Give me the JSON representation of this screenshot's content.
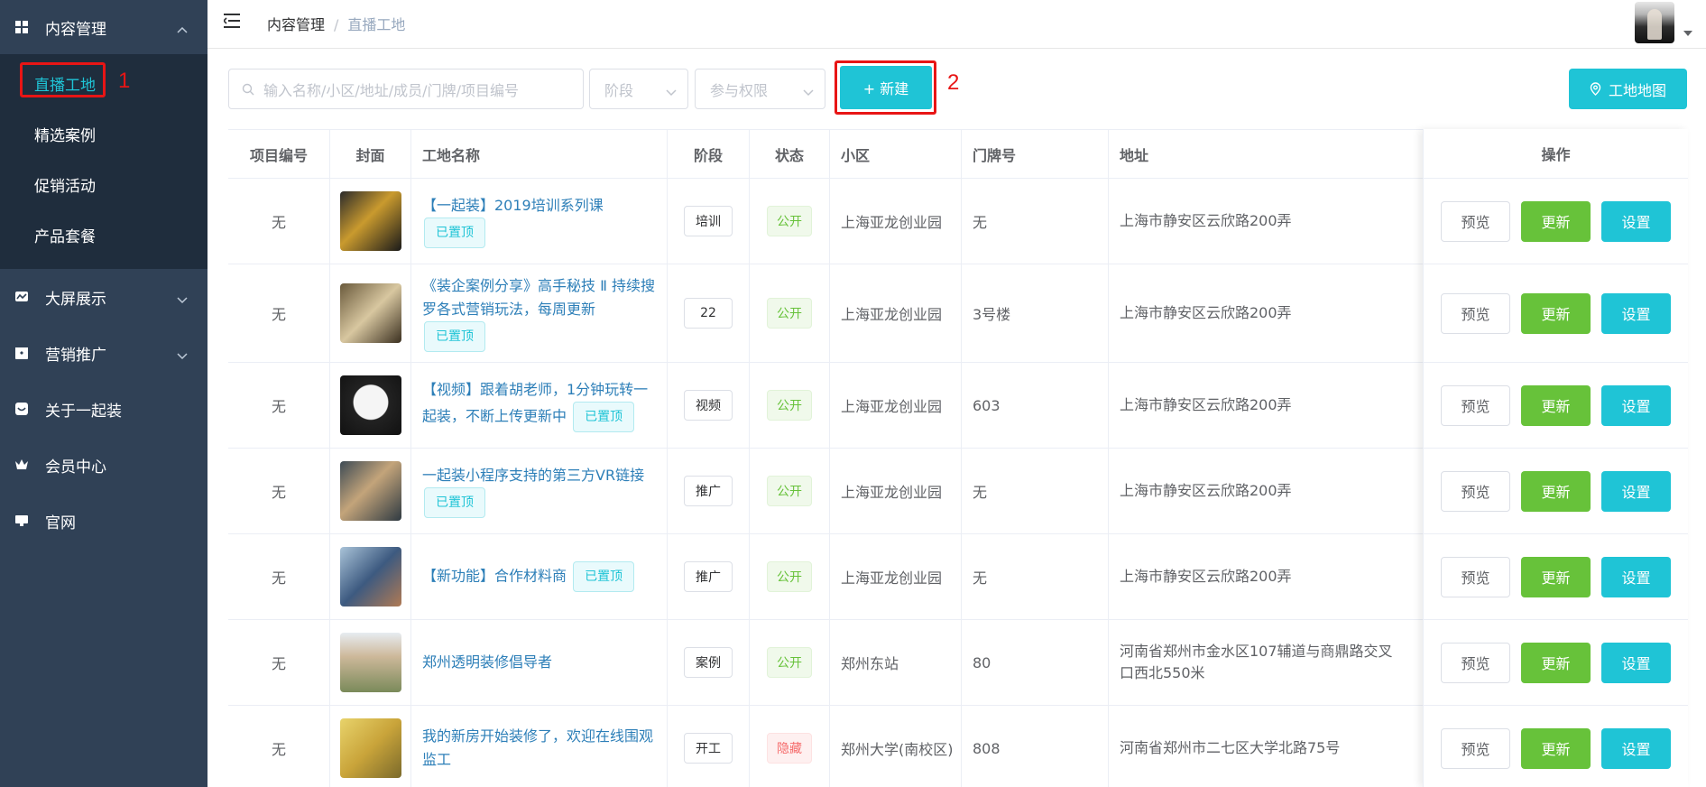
{
  "sidebar": {
    "top": {
      "label": "内容管理",
      "icon": "grid-icon"
    },
    "sub_items": [
      {
        "label": "直播工地",
        "active": true
      },
      {
        "label": "精选案例"
      },
      {
        "label": "促销活动"
      },
      {
        "label": "产品套餐"
      }
    ],
    "items": [
      {
        "label": "大屏展示",
        "icon": "chart-icon",
        "has_arrow": true
      },
      {
        "label": "营销推广",
        "icon": "gift-icon",
        "has_arrow": true
      },
      {
        "label": "关于一起装",
        "icon": "info-icon",
        "has_arrow": false
      },
      {
        "label": "会员中心",
        "icon": "crown-icon",
        "has_arrow": false
      },
      {
        "label": "官网",
        "icon": "monitor-icon",
        "has_arrow": false
      }
    ]
  },
  "annotations": {
    "n1": "1",
    "n2": "2"
  },
  "header": {
    "breadcrumb": [
      "内容管理",
      "直播工地"
    ],
    "separator": "/"
  },
  "filters": {
    "search_placeholder": "输入名称/小区/地址/成员/门牌/项目编号",
    "stage_placeholder": "阶段",
    "permission_placeholder": "参与权限"
  },
  "buttons": {
    "new": "+ 新建",
    "map": "工地地图"
  },
  "colors": {
    "sidebar_bg": "#304156",
    "submenu_bg": "#1f2d3d",
    "accent": "#1fc4d6",
    "success": "#67c23a",
    "danger": "#f56c6c",
    "highlight": "#e81515"
  },
  "table": {
    "headers": [
      "项目编号",
      "封面",
      "工地名称",
      "阶段",
      "状态",
      "小区",
      "门牌号",
      "地址",
      "操作"
    ],
    "rows": [
      {
        "no": "无",
        "cover": "cover-1",
        "title": "【一起装】2019培训系列课",
        "pinned": "已置顶",
        "stage": "培训",
        "status": "公开",
        "status_type": "pub",
        "community": "上海亚龙创业园",
        "door": "无",
        "address": "上海市静安区云欣路200弄"
      },
      {
        "no": "无",
        "cover": "cover-2",
        "title": "《装企案例分享》高手秘技 Ⅱ 持续搜罗各式营销玩法，每周更新",
        "pinned": "已置顶",
        "stage": "22",
        "status": "公开",
        "status_type": "pub",
        "community": "上海亚龙创业园",
        "door": "3号楼",
        "address": "上海市静安区云欣路200弄"
      },
      {
        "no": "无",
        "cover": "cover-3",
        "title": "【视频】跟着胡老师，1分钟玩转一起装，不断上传更新中",
        "pinned": "已置顶",
        "stage": "视频",
        "status": "公开",
        "status_type": "pub",
        "community": "上海亚龙创业园",
        "door": "603",
        "address": "上海市静安区云欣路200弄"
      },
      {
        "no": "无",
        "cover": "cover-4",
        "title": "一起装小程序支持的第三方VR链接",
        "pinned": "已置顶",
        "stage": "推广",
        "status": "公开",
        "status_type": "pub",
        "community": "上海亚龙创业园",
        "door": "无",
        "address": "上海市静安区云欣路200弄"
      },
      {
        "no": "无",
        "cover": "cover-5",
        "title": "【新功能】合作材料商",
        "pinned": "已置顶",
        "stage": "推广",
        "status": "公开",
        "status_type": "pub",
        "community": "上海亚龙创业园",
        "door": "无",
        "address": "上海市静安区云欣路200弄"
      },
      {
        "no": "无",
        "cover": "cover-6",
        "title": "郑州透明装修倡导者",
        "pinned": "",
        "stage": "案例",
        "status": "公开",
        "status_type": "pub",
        "community": "郑州东站",
        "door": "80",
        "address": "河南省郑州市金水区107辅道与商鼎路交叉口西北550米"
      },
      {
        "no": "无",
        "cover": "cover-7",
        "title": "我的新房开始装修了，欢迎在线围观监工",
        "pinned": "",
        "stage": "开工",
        "status": "隐藏",
        "status_type": "hid",
        "community": "郑州大学(南校区)",
        "door": "808",
        "address": "河南省郑州市二七区大学北路75号"
      }
    ],
    "actions": {
      "preview": "预览",
      "update": "更新",
      "setting": "设置"
    }
  }
}
